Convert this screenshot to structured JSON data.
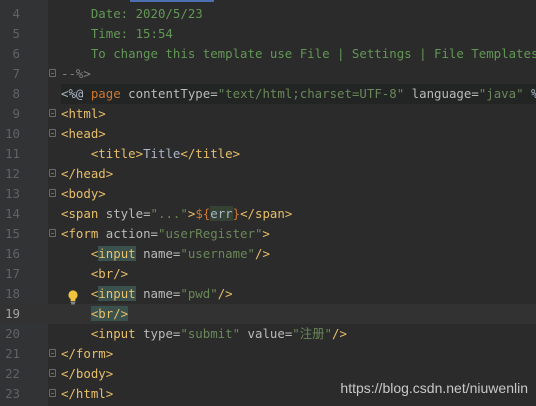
{
  "editor": {
    "lines": [
      {
        "num": "4",
        "segments": [
          {
            "t": "    Date: 2020/5/23",
            "c": "c-comment"
          }
        ]
      },
      {
        "num": "5",
        "segments": [
          {
            "t": "    Time: 15:54",
            "c": "c-comment"
          }
        ]
      },
      {
        "num": "6",
        "segments": [
          {
            "t": "    To change this template use File | Settings | File Templates.",
            "c": "c-comment"
          }
        ]
      },
      {
        "num": "7",
        "fold": true,
        "segments": [
          {
            "t": "--%>",
            "c": "c-gray"
          }
        ]
      },
      {
        "num": "8",
        "jsp": true,
        "segments": [
          {
            "t": "<%@ ",
            "c": "c-text"
          },
          {
            "t": "page ",
            "c": "c-kw"
          },
          {
            "t": "contentType=",
            "c": "c-attr"
          },
          {
            "t": "\"text/html;charset=UTF-8\"",
            "c": "c-str"
          },
          {
            "t": " language=",
            "c": "c-attr"
          },
          {
            "t": "\"java\"",
            "c": "c-str"
          },
          {
            "t": " %>",
            "c": "c-text"
          }
        ]
      },
      {
        "num": "9",
        "fold": true,
        "segments": [
          {
            "t": "<html>",
            "c": "c-tag"
          }
        ]
      },
      {
        "num": "10",
        "fold": true,
        "segments": [
          {
            "t": "<head>",
            "c": "c-tag"
          }
        ]
      },
      {
        "num": "11",
        "segments": [
          {
            "t": "    <title>",
            "c": "c-tag"
          },
          {
            "t": "Title",
            "c": "c-text"
          },
          {
            "t": "</title>",
            "c": "c-tag"
          }
        ]
      },
      {
        "num": "12",
        "fold": true,
        "segments": [
          {
            "t": "</head>",
            "c": "c-tag"
          }
        ]
      },
      {
        "num": "13",
        "fold": true,
        "segments": [
          {
            "t": "<body>",
            "c": "c-tag"
          }
        ]
      },
      {
        "num": "14",
        "segments": [
          {
            "t": "<span ",
            "c": "c-tag"
          },
          {
            "t": "style=",
            "c": "c-attr"
          },
          {
            "t": "\"...\"",
            "c": "c-str"
          },
          {
            "t": ">",
            "c": "c-tag"
          },
          {
            "t": "${",
            "c": "c-kw"
          },
          {
            "t": "err",
            "c": "c-text err-hl"
          },
          {
            "t": "}",
            "c": "c-kw"
          },
          {
            "t": "</span>",
            "c": "c-tag"
          }
        ]
      },
      {
        "num": "15",
        "fold": true,
        "segments": [
          {
            "t": "<form ",
            "c": "c-tag"
          },
          {
            "t": "action=",
            "c": "c-attr"
          },
          {
            "t": "\"userRegister\"",
            "c": "c-str"
          },
          {
            "t": ">",
            "c": "c-tag"
          }
        ]
      },
      {
        "num": "16",
        "segments": [
          {
            "t": "    <",
            "c": "c-tag"
          },
          {
            "t": "input",
            "c": "c-tag input-hl"
          },
          {
            "t": " name=",
            "c": "c-attr"
          },
          {
            "t": "\"username\"",
            "c": "c-str"
          },
          {
            "t": "/>",
            "c": "c-tag"
          }
        ]
      },
      {
        "num": "17",
        "segments": [
          {
            "t": "    <br/>",
            "c": "c-tag"
          }
        ]
      },
      {
        "num": "18",
        "segments": [
          {
            "t": "    <",
            "c": "c-tag"
          },
          {
            "t": "input",
            "c": "c-tag input-hl"
          },
          {
            "t": " name=",
            "c": "c-attr"
          },
          {
            "t": "\"pwd\"",
            "c": "c-str"
          },
          {
            "t": "/>",
            "c": "c-tag"
          }
        ]
      },
      {
        "num": "19",
        "current": true,
        "segments": [
          {
            "t": "    ",
            "c": "c-tag"
          },
          {
            "t": "<br/>",
            "c": "c-tag br-hl"
          }
        ]
      },
      {
        "num": "20",
        "segments": [
          {
            "t": "    <input ",
            "c": "c-tag"
          },
          {
            "t": "type=",
            "c": "c-attr"
          },
          {
            "t": "\"submit\"",
            "c": "c-str"
          },
          {
            "t": " value=",
            "c": "c-attr"
          },
          {
            "t": "\"注册\"",
            "c": "c-str"
          },
          {
            "t": "/>",
            "c": "c-tag"
          }
        ]
      },
      {
        "num": "21",
        "fold": true,
        "segments": [
          {
            "t": "</form>",
            "c": "c-tag"
          }
        ]
      },
      {
        "num": "22",
        "fold": true,
        "segments": [
          {
            "t": "</body>",
            "c": "c-tag"
          }
        ]
      },
      {
        "num": "23",
        "fold": true,
        "segments": [
          {
            "t": "</html>",
            "c": "c-tag"
          }
        ]
      }
    ]
  },
  "watermark": "https://blog.csdn.net/niuwenlin",
  "colors": {
    "background": "#2b2b2b",
    "tag": "#e8bf6a",
    "string": "#6a8759",
    "comment": "#629755",
    "keyword": "#cc7832"
  }
}
